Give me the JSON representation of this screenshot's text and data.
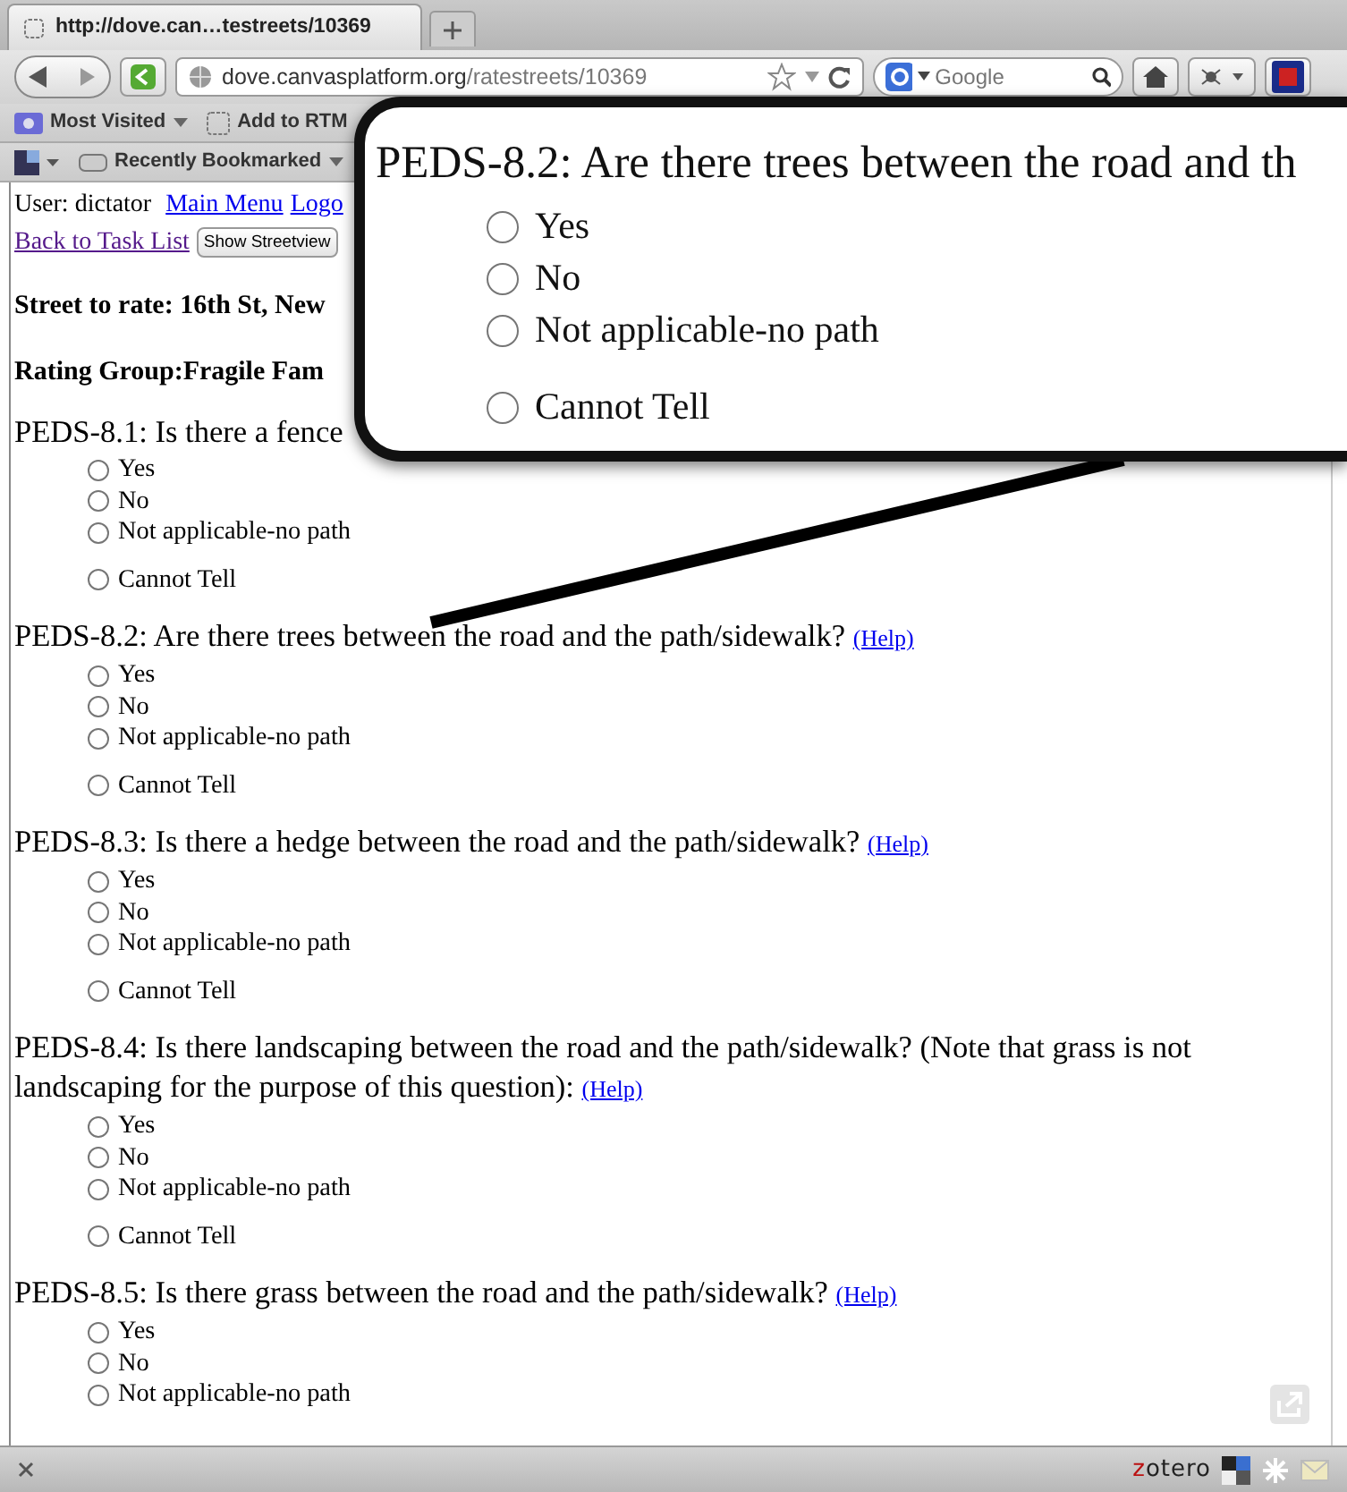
{
  "browser": {
    "tab_title": "http://dove.can…testreets/10369",
    "url_host": "dove.canvasplatform.org",
    "url_path": "/ratestreets/10369",
    "search_placeholder": "Google"
  },
  "bookmarks": [
    "Most Visited",
    "Add to RTM"
  ],
  "bookmarks_2": [
    "Recently Bookmarked"
  ],
  "page": {
    "user": "User: dictator",
    "links": [
      "Main Menu",
      "Logo"
    ],
    "back_link": "Back to Task List",
    "button": "Show Streetview",
    "street": "Street to rate: 16th St, New",
    "group": "Rating Group:Fragile Fam"
  },
  "questions": [
    {
      "text": "PEDS-8.1: Is there a fence",
      "options": [
        {
          "label": "Yes",
          "selected": false
        },
        {
          "label": "No",
          "selected": false
        },
        {
          "label": "Not applicable-no path",
          "selected": false
        },
        {
          "label": "Cannot Tell",
          "selected": false
        }
      ]
    },
    {
      "text": "PEDS-8.2: Are there trees between the road and the path/sidewalk?",
      "help": "(Help)",
      "options": [
        {
          "label": "Yes",
          "selected": false
        },
        {
          "label": "No",
          "selected": false
        },
        {
          "label": "Not applicable-no path",
          "selected": false
        },
        {
          "label": "Cannot Tell",
          "selected": false
        }
      ]
    },
    {
      "text": "PEDS-8.3: Is there a hedge between the road and the path/sidewalk?",
      "help": "(Help)",
      "options": [
        {
          "label": "Yes",
          "selected": false
        },
        {
          "label": "No",
          "selected": false
        },
        {
          "label": "Not applicable-no path",
          "selected": false
        },
        {
          "label": "Cannot Tell",
          "selected": false
        }
      ]
    },
    {
      "text": "PEDS-8.4: Is there landscaping between the road and the path/sidewalk? (Note that grass is not landscaping for the purpose of this question):",
      "help": "(Help)",
      "options": [
        {
          "label": "Yes",
          "selected": false
        },
        {
          "label": "No",
          "selected": false
        },
        {
          "label": "Not applicable-no path",
          "selected": false
        },
        {
          "label": "Cannot Tell",
          "selected": false
        }
      ]
    },
    {
      "text": "PEDS-8.5: Is there grass between the road and the path/sidewalk?",
      "help": "(Help)",
      "options": [
        {
          "label": "Yes",
          "selected": false
        },
        {
          "label": "No",
          "selected": false
        },
        {
          "label": "Not applicable-no path",
          "selected": false
        }
      ]
    }
  ],
  "callout": {
    "text": "PEDS-8.2: Are there trees between the road and th",
    "options": [
      {
        "label": "Yes",
        "selected": false
      },
      {
        "label": "No",
        "selected": false
      },
      {
        "label": "Not applicable-no path",
        "selected": false
      },
      {
        "label": "Cannot Tell",
        "selected": false
      }
    ]
  },
  "status_bar": {
    "zotero": "zotero"
  }
}
